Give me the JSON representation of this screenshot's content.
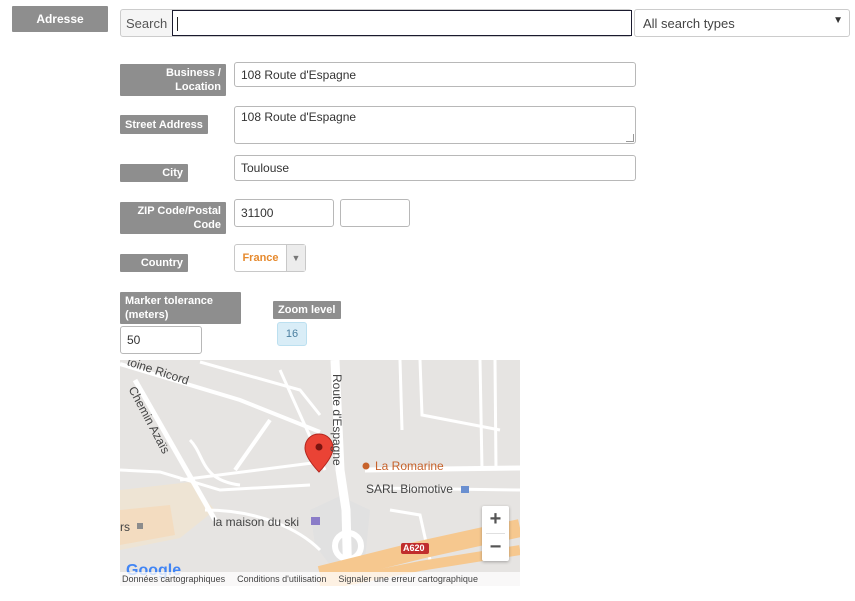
{
  "section_label": "Adresse",
  "search": {
    "label": "Search",
    "value": "",
    "type_select": "All search types"
  },
  "fields": {
    "business_label": "Business / Location",
    "business_value": "108 Route d'Espagne",
    "street_label": "Street Address",
    "street_value": "108 Route d'Espagne",
    "city_label": "City",
    "city_value": "Toulouse",
    "zip_label": "ZIP Code/Postal Code",
    "zip_value": "31100",
    "zip_ext_value": "",
    "country_label": "Country",
    "country_value": "France",
    "tolerance_label": "Marker tolerance (meters)",
    "tolerance_value": "50",
    "zoom_label": "Zoom level",
    "zoom_value": "16"
  },
  "map": {
    "streets": [
      "Route d'Espagne",
      "toine Ricord",
      "Chemin Azaïs"
    ],
    "places": [
      "La Romarine",
      "SARL Biomotive",
      "la maison du ski",
      "rs"
    ],
    "road_shield": "A620",
    "zoom_in": "+",
    "zoom_out": "−",
    "logo": "Google",
    "footer": [
      "Données cartographiques",
      "Conditions d'utilisation",
      "Signaler une erreur cartographique"
    ],
    "colors": {
      "marker": "#ea4335",
      "motorway": "#f6c88f",
      "land": "#e6e4e2",
      "road": "#ffffff"
    }
  }
}
